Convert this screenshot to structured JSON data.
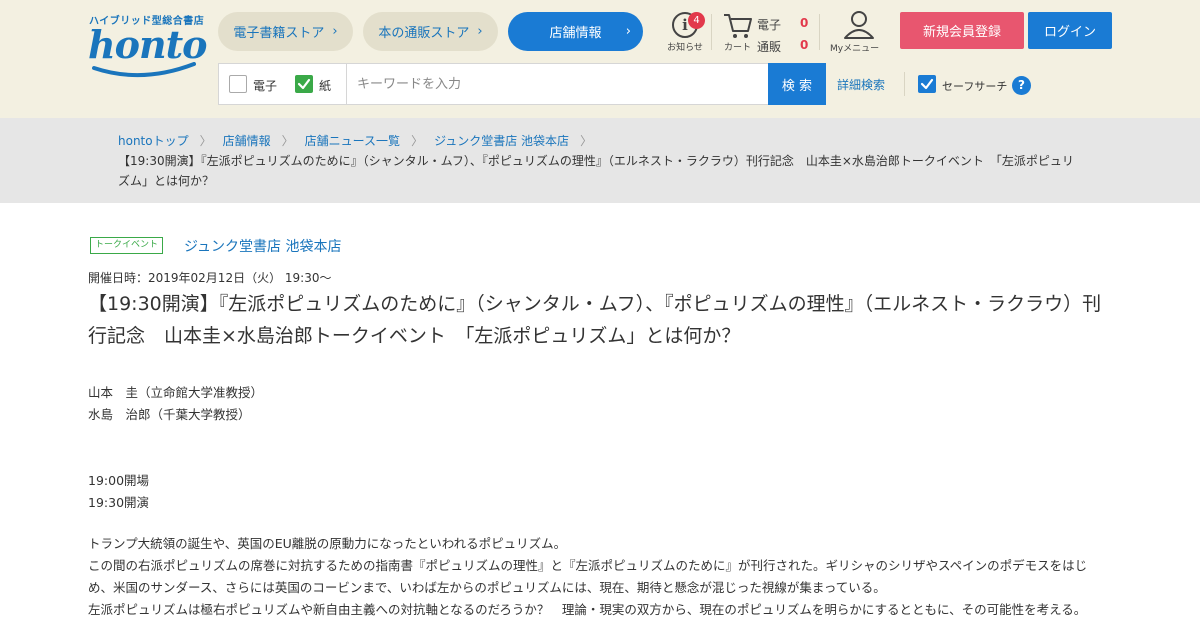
{
  "header": {
    "logo_tagline": "ハイブリッド型総合書店",
    "logo_text": "honto",
    "tabs": [
      {
        "label": "電子書籍ストア"
      },
      {
        "label": "本の通販ストア"
      },
      {
        "label": "店舗情報"
      }
    ],
    "notice": {
      "label": "お知らせ",
      "badge": "4"
    },
    "cart": {
      "label": "カート",
      "ebook_label": "電子",
      "ebook_count": "0",
      "paper_label": "通販",
      "paper_count": "0"
    },
    "mymenu_label": "Myメニュー",
    "register_label": "新規会員登録",
    "login_label": "ログイン",
    "search": {
      "ebook_label": "電子",
      "paper_label": "紙",
      "placeholder": "キーワードを入力",
      "button_label": "検 索",
      "advanced_label": "詳細検索",
      "safe_search_label": "セーフサーチ",
      "help_label": "?"
    }
  },
  "breadcrumb": {
    "items": [
      "hontoトップ",
      "店舗情報",
      "店舗ニュース一覧",
      "ジュンク堂書店 池袋本店"
    ],
    "current": "【19:30開演】『左派ポピュリズムのために』（シャンタル・ムフ）、『ポピュリズムの理性』（エルネスト・ラクラウ）刊行記念　山本圭×水島治郎トークイベント　「左派ポピュリズム」とは何か？"
  },
  "event": {
    "category": "トークイベント",
    "store": "ジュンク堂書店  池袋本店",
    "date": "開催日時：2019年02月12日（火） 19:30～",
    "title": "【19:30開演】『左派ポピュリズムのために』（シャンタル・ムフ）、『ポピュリズムの理性』（エルネスト・ラクラウ）刊行記念　山本圭×水島治郎トークイベント　「左派ポピュリズム」とは何か？",
    "speaker1": "山本　圭（立命館大学准教授）",
    "speaker2": "水島　治郎（千葉大学教授）",
    "doors": "19:00開場",
    "start": "19:30開演",
    "para1": "トランプ大統領の誕生や、英国のEU離脱の原動力になったといわれるポピュリズム。",
    "para2": "この間の右派ポピュリズムの席巻に対抗するための指南書『ポピュリズムの理性』と『左派ポピュリズムのために』が刊行された。ギリシャのシリザやスペインのポデモスをはじめ、米国のサンダース、さらには英国のコービンまで、いわば左からのポピュリズムには、現在、期待と懸念が混じった視線が集まっている。",
    "para3": "左派ポピュリズムは極右ポピュリズムや新自由主義への対抗軸となるのだろうか？　理論・現実の双方から、現在のポピュリズムを明らかにするとともに、その可能性を考える。"
  },
  "colors": {
    "accent_blue": "#1a7bd4",
    "register_pink": "#e8566f",
    "header_bg": "#f3f0e1",
    "event_green": "#3aa948"
  }
}
